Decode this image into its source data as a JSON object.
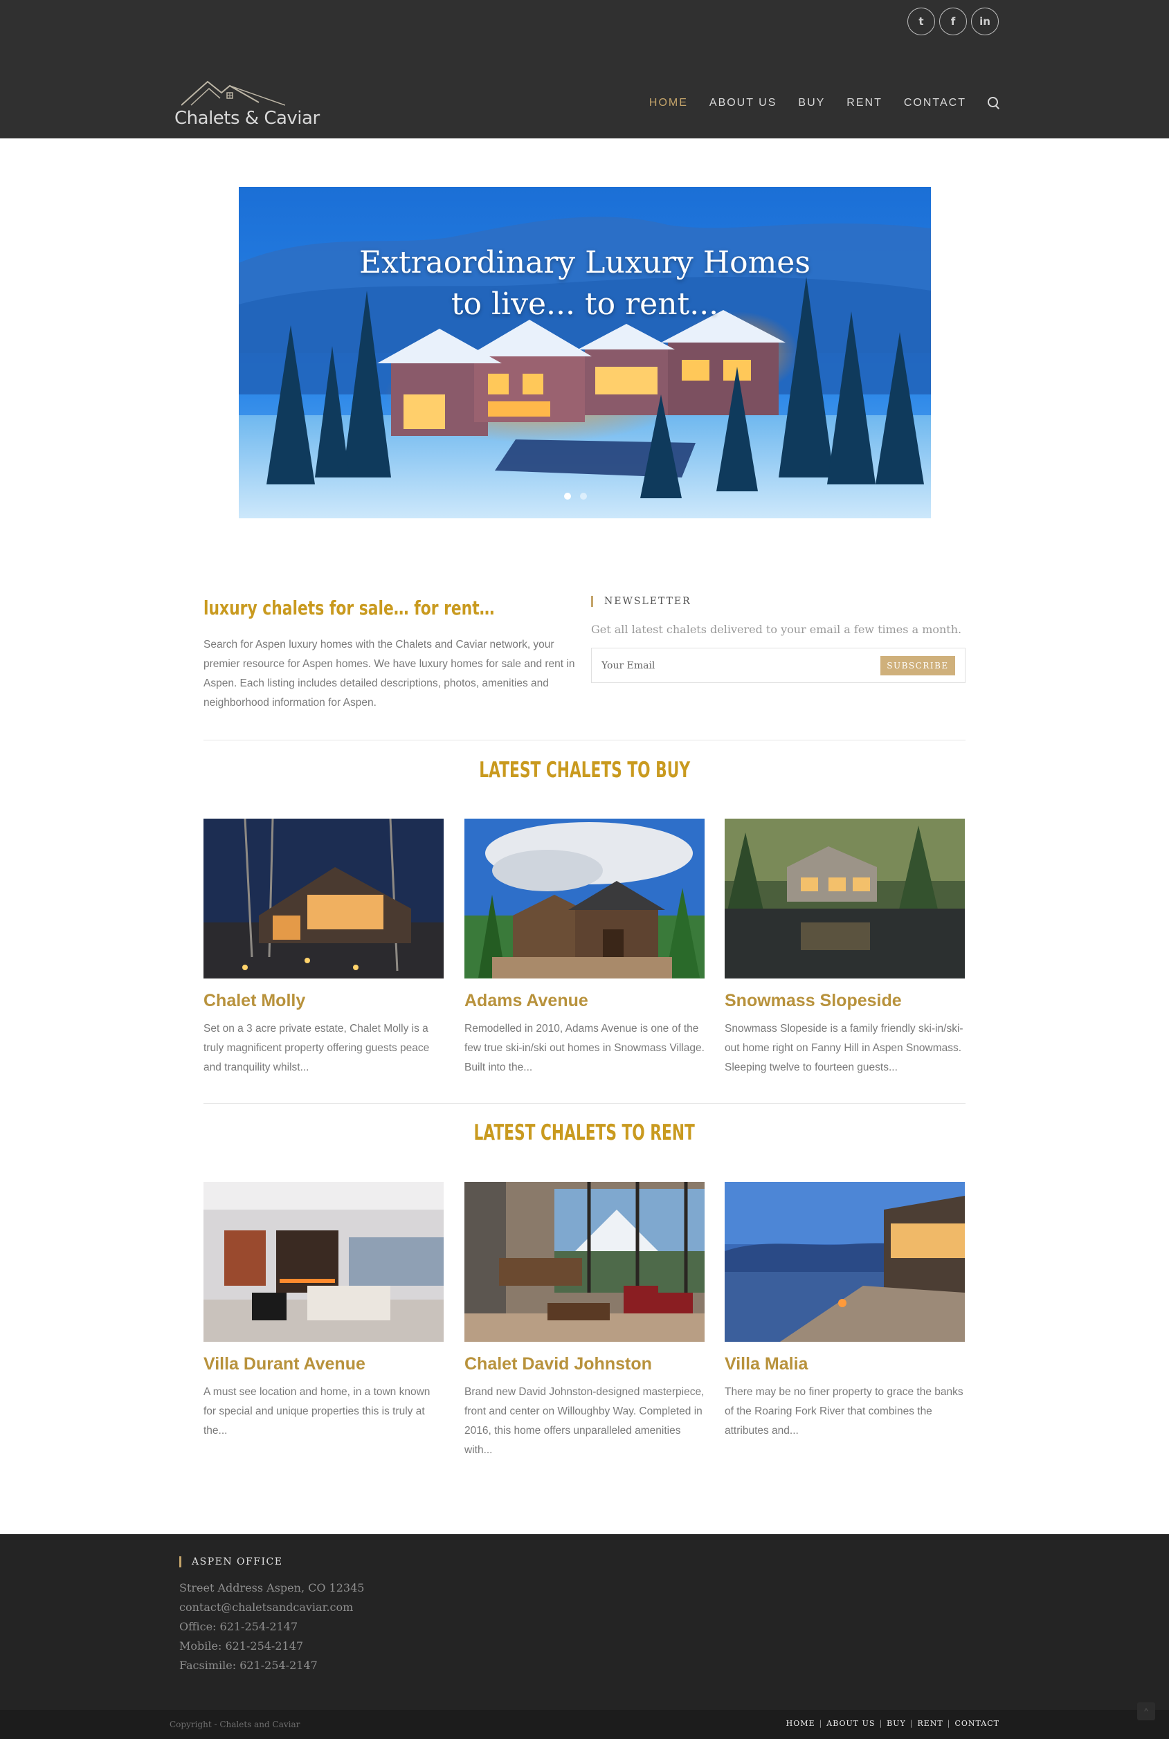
{
  "header": {
    "brand": "Chalets & Caviar",
    "nav": [
      {
        "label": "Home",
        "active": true
      },
      {
        "label": "About us"
      },
      {
        "label": "Buy"
      },
      {
        "label": "Rent"
      },
      {
        "label": "Contact"
      }
    ],
    "social": [
      {
        "icon": "twitter-icon",
        "glyph": "t"
      },
      {
        "icon": "facebook-icon",
        "glyph": "f"
      },
      {
        "icon": "linkedin-icon",
        "glyph": "in"
      }
    ],
    "accent_color": "#c4a46a"
  },
  "hero": {
    "title_line1": "Extraordinary Luxury Homes",
    "title_line2": "to live... to rent...",
    "slides": 2,
    "active_slide": 1
  },
  "intro": {
    "title": "luxury chalets for sale… for rent…",
    "text": "Search for Aspen luxury homes with the Chalets and Caviar network, your premier resource for Aspen homes. We have luxury homes for sale and rent in Aspen. Each listing includes detailed descriptions, photos, amenities and neighborhood information for Aspen."
  },
  "newsletter": {
    "label": "NEWSLETTER",
    "subtitle": "Get all latest chalets delivered to your email a few times a month.",
    "placeholder": "Your Email",
    "button": "SUBSCRIBE"
  },
  "buy": {
    "title": "LATEST CHALETS TO BUY",
    "items": [
      {
        "name": "Chalet Molly",
        "desc": "Set on a 3 acre private estate, Chalet Molly is a truly magnificent property offering guests peace and tranquility whilst..."
      },
      {
        "name": "Adams Avenue",
        "desc": "Remodelled in 2010, Adams Avenue is one of the few true ski-in/ski out homes in Snowmass Village. Built into the..."
      },
      {
        "name": "Snowmass Slopeside",
        "desc": "Snowmass Slopeside is a family friendly ski-in/ski-out home right on Fanny Hill in Aspen Snowmass. Sleeping twelve to fourteen guests..."
      }
    ]
  },
  "rent": {
    "title": "LATEST CHALETS TO RENT",
    "items": [
      {
        "name": "Villa Durant Avenue",
        "desc": "A must see location and home, in a town known for special and unique properties this is truly at the..."
      },
      {
        "name": "Chalet David Johnston",
        "desc": "Brand new David Johnston-designed masterpiece, front and center on Willoughby Way. Completed in 2016, this home offers unparalleled amenities with..."
      },
      {
        "name": "Villa Malia",
        "desc": "There may be no finer property to grace the banks of the Roaring Fork River that combines the attributes and..."
      }
    ]
  },
  "footer": {
    "label": "ASPEN OFFICE",
    "address": "Street Address Aspen, CO 12345",
    "email": "contact@chaletsandcaviar.com",
    "office": "Office: 621-254-2147",
    "mobile": "Mobile: 621-254-2147",
    "fax": "Facsimile: 621-254-2147",
    "copyright": "Copyright - Chalets and Caviar",
    "nav": [
      "HOME",
      "ABOUT US",
      "BUY",
      "RENT",
      "CONTACT"
    ]
  }
}
